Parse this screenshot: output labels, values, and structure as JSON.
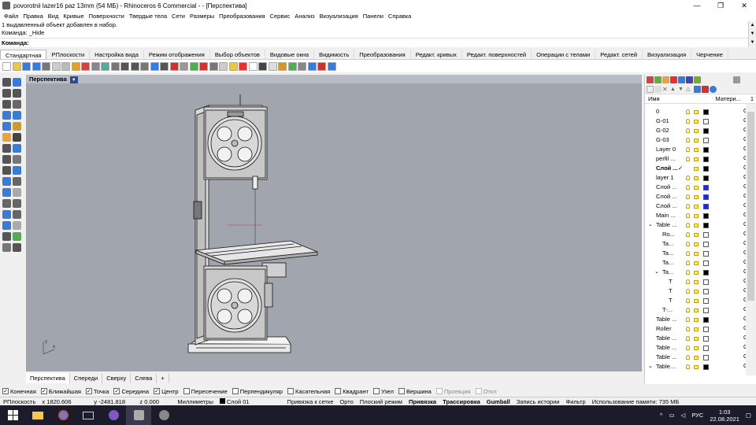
{
  "window": {
    "title": "povorotnii lazer16 paz 13mm (54 МБ) - Rhinoceros 6 Commercial - - [Перспектива]"
  },
  "menu": [
    "Файл",
    "Правка",
    "Вид",
    "Кривые",
    "Поверхности",
    "Твердые тела",
    "Сети",
    "Размеры",
    "Преобразования",
    "Сервис",
    "Анализ",
    "Визуализация",
    "Панели",
    "Справка"
  ],
  "command": {
    "history1": "1 выдавленный объект добавлен в набор.",
    "history2": "Команда: _Hide",
    "prompt": "Команда:"
  },
  "tabs": [
    "Стандартная",
    "РПлоскости",
    "Настройка вида",
    "Режим отображения",
    "Выбор объектов",
    "Видовые окна",
    "Видимость",
    "Преобразования",
    "Редакт. кривых",
    "Редакт. поверхностей",
    "Операции с телами",
    "Редакт. сетей",
    "Визуализация",
    "Черчение"
  ],
  "viewport": {
    "name": "Перспектива",
    "axis_x": "x",
    "axis_z": "z"
  },
  "viewport_tabs": [
    "Перспектива",
    "Спереди",
    "Сверху",
    "Слева",
    "+"
  ],
  "layers": {
    "col_name": "Имя",
    "col_material": "Матери...",
    "col_extra": "1",
    "rows": [
      {
        "name": "0",
        "indent": 0,
        "color": "#000000",
        "chev": "",
        "current": false
      },
      {
        "name": "G-01",
        "indent": 0,
        "color": "#ffffff",
        "chev": "",
        "current": false
      },
      {
        "name": "G-02",
        "indent": 0,
        "color": "#000000",
        "chev": "",
        "current": false
      },
      {
        "name": "G-03",
        "indent": 0,
        "color": "#ffffff",
        "chev": "",
        "current": false
      },
      {
        "name": "Layer 0",
        "indent": 0,
        "color": "#000000",
        "chev": "",
        "current": false
      },
      {
        "name": "perfil ...",
        "indent": 0,
        "color": "#000000",
        "chev": "",
        "current": false
      },
      {
        "name": "Слой ...",
        "indent": 0,
        "color": "#000000",
        "chev": "",
        "current": true
      },
      {
        "name": "layer 1",
        "indent": 0,
        "color": "#000000",
        "chev": "",
        "current": false
      },
      {
        "name": "Слой ...",
        "indent": 0,
        "color": "#1c2bd6",
        "chev": "",
        "current": false
      },
      {
        "name": "Слой ...",
        "indent": 0,
        "color": "#1c2bd6",
        "chev": "",
        "current": false
      },
      {
        "name": "Слой ...",
        "indent": 0,
        "color": "#1c2bd6",
        "chev": "",
        "current": false
      },
      {
        "name": "Main ...",
        "indent": 0,
        "color": "#000000",
        "chev": "",
        "current": false
      },
      {
        "name": "Table ...",
        "indent": 0,
        "color": "#000000",
        "chev": "⌄",
        "current": false
      },
      {
        "name": "Ro...",
        "indent": 1,
        "color": "#ffffff",
        "chev": "",
        "current": false
      },
      {
        "name": "Ta...",
        "indent": 1,
        "color": "#ffffff",
        "chev": "",
        "current": false
      },
      {
        "name": "Ta...",
        "indent": 1,
        "color": "#ffffff",
        "chev": "",
        "current": false
      },
      {
        "name": "Ta...",
        "indent": 1,
        "color": "#ffffff",
        "chev": "",
        "current": false
      },
      {
        "name": "Ta...",
        "indent": 1,
        "color": "#000000",
        "chev": "⌄",
        "current": false
      },
      {
        "name": "T",
        "indent": 2,
        "color": "#ffffff",
        "chev": "",
        "current": false
      },
      {
        "name": "T",
        "indent": 2,
        "color": "#ffffff",
        "chev": "",
        "current": false
      },
      {
        "name": "T",
        "indent": 2,
        "color": "#ffffff",
        "chev": "",
        "current": false
      },
      {
        "name": "T-...",
        "indent": 1,
        "color": "#ffffff",
        "chev": "",
        "current": false
      },
      {
        "name": "Table ...",
        "indent": 0,
        "color": "#000000",
        "chev": "",
        "current": false
      },
      {
        "name": "Roller",
        "indent": 0,
        "color": "#ffffff",
        "chev": "",
        "current": false
      },
      {
        "name": "Table ...",
        "indent": 0,
        "color": "#ffffff",
        "chev": "",
        "current": false
      },
      {
        "name": "Table ...",
        "indent": 0,
        "color": "#ffffff",
        "chev": "",
        "current": false
      },
      {
        "name": "Table ...",
        "indent": 0,
        "color": "#ffffff",
        "chev": "",
        "current": false
      },
      {
        "name": "Table...",
        "indent": 0,
        "color": "#000000",
        "chev": "⌄",
        "current": false
      }
    ],
    "mat": "C"
  },
  "osnaps": [
    {
      "label": "Конечная",
      "on": true,
      "dim": false
    },
    {
      "label": "Ближайшая",
      "on": true,
      "dim": false
    },
    {
      "label": "Точка",
      "on": true,
      "dim": false
    },
    {
      "label": "Середина",
      "on": true,
      "dim": false
    },
    {
      "label": "Центр",
      "on": true,
      "dim": false
    },
    {
      "label": "Пересечение",
      "on": false,
      "dim": false
    },
    {
      "label": "Перпендикуляр",
      "on": false,
      "dim": false
    },
    {
      "label": "Касательная",
      "on": false,
      "dim": false
    },
    {
      "label": "Квадрант",
      "on": false,
      "dim": false
    },
    {
      "label": "Узел",
      "on": false,
      "dim": false
    },
    {
      "label": "Вершина",
      "on": false,
      "dim": false
    },
    {
      "label": "Проекция",
      "on": false,
      "dim": true
    },
    {
      "label": "Откл",
      "on": false,
      "dim": true
    }
  ],
  "status": {
    "cplane": "РПлоскость",
    "x": "x 1820.606",
    "y": "y -2481.818",
    "z": "z 0.000",
    "units": "Миллиметры",
    "layer": "Слой 01",
    "grid_snap": "Привязка к сетке",
    "ortho": "Орто",
    "planar": "Плоский режим",
    "osnap": "Привязка",
    "smarttrack": "Трассировка",
    "gumball": "Gumball",
    "history": "Запись истории",
    "filter": "Фильтр",
    "memory": "Использование памяти: 735 МБ"
  },
  "taskbar": {
    "lang": "РУС",
    "time": "1:03",
    "date": "22.08.2021"
  }
}
